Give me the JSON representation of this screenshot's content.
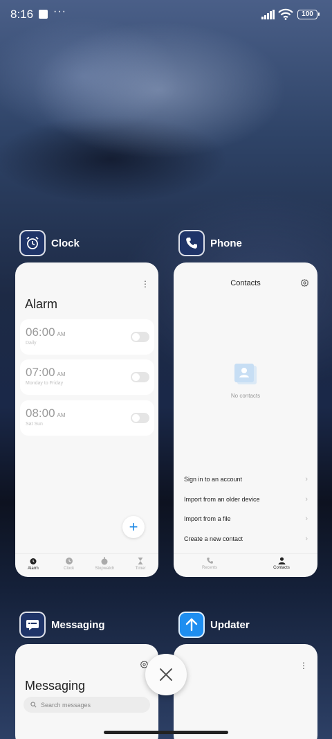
{
  "status_bar": {
    "time": "8:16",
    "dots": "···",
    "battery": "100"
  },
  "apps": {
    "clock": {
      "title": "Clock",
      "screen_title": "Alarm",
      "alarms": [
        {
          "time": "06:00",
          "ampm": "AM",
          "label": "Daily",
          "enabled": false
        },
        {
          "time": "07:00",
          "ampm": "AM",
          "label": "Monday to Friday",
          "enabled": false
        },
        {
          "time": "08:00",
          "ampm": "AM",
          "label": "Sat Sun",
          "enabled": false
        }
      ],
      "fab_label": "+",
      "tabs": [
        "Alarm",
        "Clock",
        "Stopwatch",
        "Timer"
      ],
      "active_tab": "Alarm"
    },
    "phone": {
      "title": "Phone",
      "screen_title": "Contacts",
      "empty_text": "No contacts",
      "options": [
        "Sign in to an account",
        "Import from an older device",
        "Import from a file",
        "Create a new contact"
      ],
      "tabs": [
        "Recents",
        "Contacts"
      ],
      "active_tab": "Contacts"
    },
    "messaging": {
      "title": "Messaging",
      "screen_title": "Messaging",
      "search_placeholder": "Search messages"
    },
    "updater": {
      "title": "Updater"
    }
  },
  "chevron": "›",
  "close_label": "close all",
  "colors": {
    "accent": "#1e88e5",
    "updater_icon": "#1e8ef0",
    "dark_icon": "#1f3468"
  }
}
